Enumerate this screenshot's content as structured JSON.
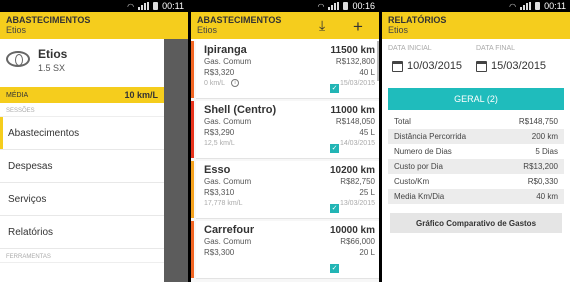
{
  "status": {
    "time_1": "00:11",
    "time_2": "00:16",
    "time_3": "00:11",
    "signal_label": "0.1K"
  },
  "screen1": {
    "app_title": "ABASTECIMENTOS",
    "app_subtitle": "Etios",
    "car_name": "Etios",
    "car_version": "1.5 SX",
    "media_label": "MÉDIA",
    "media_value": "10 km/L",
    "section_sessoes": "SESSÕES",
    "menu": [
      "Abastecimentos",
      "Despesas",
      "Serviços",
      "Relatórios"
    ],
    "section_ferramentas": "FERRAMENTAS"
  },
  "screen2": {
    "app_title": "ABASTECIMENTOS",
    "app_subtitle": "Etios",
    "actions": [
      "download-icon",
      "add-icon"
    ],
    "entries": [
      {
        "station": "Ipiranga",
        "km": "11500 km",
        "fuel": "Gas. Comum",
        "price": "R$3,320",
        "total": "R$132,800",
        "liters": "40 L",
        "avg": "0 km/L",
        "date": "15/03/2015",
        "color": "#f26522"
      },
      {
        "station": "Shell (Centro)",
        "km": "11000 km",
        "fuel": "Gas. Comum",
        "price": "R$3,290",
        "total": "R$148,050",
        "liters": "45 L",
        "avg": "12,5 km/L",
        "date": "14/03/2015",
        "color": "#e8331c"
      },
      {
        "station": "Esso",
        "km": "10200 km",
        "fuel": "Gas. Comum",
        "price": "R$3,310",
        "total": "R$82,750",
        "liters": "25 L",
        "avg": "17,778 km/L",
        "date": "13/03/2015",
        "color": "#f5a21d"
      },
      {
        "station": "Carrefour",
        "km": "10000 km",
        "fuel": "Gas. Comum",
        "price": "R$3,300",
        "total": "R$66,000",
        "liters": "20 L",
        "avg": "",
        "date": "",
        "color": "#f26522"
      }
    ]
  },
  "screen3": {
    "app_title": "RELATÓRIOS",
    "app_subtitle": "Etios",
    "date_initial_label": "DATA INICIAL",
    "date_final_label": "DATA FINAL",
    "date_initial": "10/03/2015",
    "date_final": "15/03/2015",
    "geral_label": "GERAL (2)",
    "stats": [
      {
        "label": "Total",
        "value": "R$148,750"
      },
      {
        "label": "Distância Percorrida",
        "value": "200 km"
      },
      {
        "label": "Numero de Dias",
        "value": "5 Dias"
      },
      {
        "label": "Custo por Dia",
        "value": "R$13,200"
      },
      {
        "label": "Custo/Km",
        "value": "R$0,330"
      },
      {
        "label": "Media Km/Dia",
        "value": "40 km"
      }
    ],
    "chart_button": "Gráfico Comparativo de Gastos"
  }
}
